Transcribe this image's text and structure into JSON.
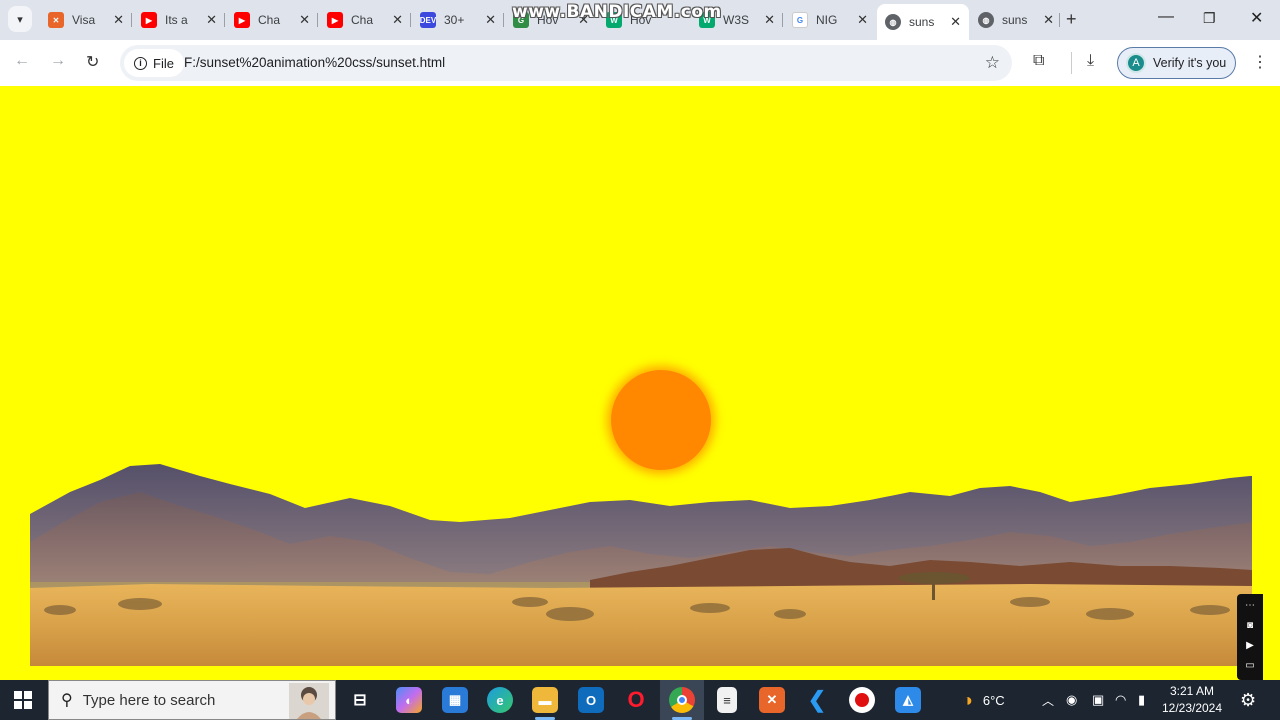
{
  "browser": {
    "tabs": [
      {
        "label": "Visa",
        "favicon": "xampp-icon",
        "color": "#e8662a"
      },
      {
        "label": "Its a",
        "favicon": "youtube-icon",
        "color": "#ff0000"
      },
      {
        "label": "Cha",
        "favicon": "youtube-icon",
        "color": "#ff0000"
      },
      {
        "label": "Cha",
        "favicon": "youtube-icon",
        "color": "#ff0000"
      },
      {
        "label": "30+",
        "favicon": "dev-icon",
        "color": "#3b49df"
      },
      {
        "label": "Hov",
        "favicon": "geeksforgeeks-icon",
        "color": "#2f8d46"
      },
      {
        "label": "Hov",
        "favicon": "w3schools-icon",
        "color": "#04aa6d"
      },
      {
        "label": "W3S",
        "favicon": "w3schools-icon",
        "color": "#04aa6d"
      },
      {
        "label": "NIG",
        "favicon": "google-icon",
        "color": "#4285f4"
      },
      {
        "label": "suns",
        "favicon": "globe-icon",
        "color": "#5f6368",
        "active": true
      },
      {
        "label": "suns",
        "favicon": "globe-icon",
        "color": "#5f6368"
      }
    ],
    "watermark": "www.BANDICAM.com",
    "address_bar": {
      "site_info_label": "File",
      "url": "F:/sunset%20animation%20css/sunset.html"
    },
    "profile_button": {
      "label": "Verify it's you",
      "avatar_letter": "A"
    }
  },
  "page": {
    "background_color": "#ffff00",
    "sun_color": "#ff8800"
  },
  "taskbar": {
    "search_placeholder": "Type here to search",
    "weather": "6°C",
    "time": "3:21 AM",
    "date": "12/23/2024"
  }
}
